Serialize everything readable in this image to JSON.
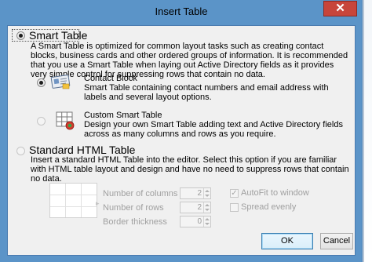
{
  "window": {
    "title": "Insert Table",
    "close_glyph": "✕"
  },
  "smart_table": {
    "label": "Smart Table",
    "description": "A Smart Table is optimized for common layout tasks such as creating contact blocks, business cards and other ordered groups of information. It is recommended that you use a Smart Table when laying out Active Directory fields as it provides very simple control for suppressing rows that contain no data.",
    "options": [
      {
        "title": "Contact Block",
        "description": "Smart Table containing contact numbers and email address with labels and several layout options.",
        "icon": "contact-card-icon"
      },
      {
        "title": "Custom Smart Table",
        "description": "Design your own Smart Table adding text and Active Directory fields across as many columns and rows as you require.",
        "icon": "custom-table-icon"
      }
    ]
  },
  "standard_table": {
    "label": "Standard HTML Table",
    "description": "Insert a standard HTML Table into the editor. Select this option if you are familiar with HTML table layout and design and have no need to suppress rows that contain no data.",
    "columns_label": "Number of columns",
    "columns_value": "2",
    "rows_label": "Number of rows",
    "rows_value": "2",
    "border_label": "Border thickness",
    "border_value": "0",
    "autofit_label": "AutoFit to window",
    "autofit_checked": true,
    "spread_label": "Spread evenly",
    "spread_checked": false,
    "preview_icon": "table-grid-icon"
  },
  "buttons": {
    "ok": "OK",
    "cancel": "Cancel"
  },
  "colors": {
    "title_bar": "#5b94c8",
    "close_button": "#c7453b",
    "dialog_background": "#f0f0f0"
  }
}
